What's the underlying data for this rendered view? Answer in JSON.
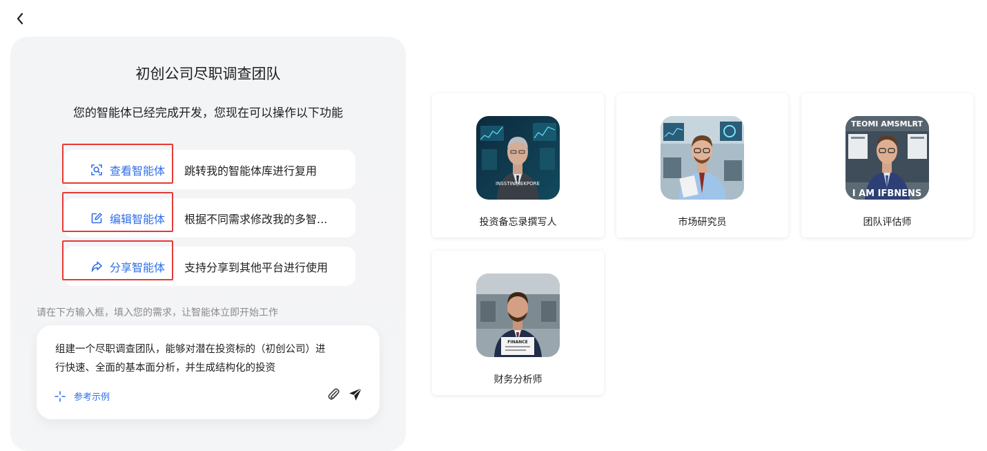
{
  "header": {
    "back_icon": "chevron-left-icon"
  },
  "panel": {
    "title": "初创公司尽职调查团队",
    "subtitle": "您的智能体已经完成开发，您现在可以操作以下功能",
    "actions": [
      {
        "label": "查看智能体",
        "description": "跳转我的智能体库进行复用",
        "icon": "view-search-icon"
      },
      {
        "label": "编辑智能体",
        "description": "根据不同需求修改我的多智...",
        "icon": "edit-icon"
      },
      {
        "label": "分享智能体",
        "description": "支持分享到其他平台进行使用",
        "icon": "share-icon"
      }
    ],
    "hint": "请在下方输入框，填入您的需求，让智能体立即开始工作",
    "input": {
      "value": "组建一个尽职调查团队，能够对潜在投资标的（初创公司）进行快速、全面的基本面分析，并生成结构化的投资",
      "example_label": "参考示例"
    }
  },
  "agents": [
    {
      "name": "投资备忘录撰写人",
      "poster_text": "INSSTINIMEKPORE"
    },
    {
      "name": "市场研究员",
      "poster_text": ""
    },
    {
      "name": "团队评估师",
      "poster_text": "TEOMI AMSMLRT",
      "poster_text_2": "I AM IFBNENS"
    },
    {
      "name": "财务分析师",
      "poster_text": "FINANCE"
    }
  ],
  "colors": {
    "accent": "#2f6fe8",
    "highlight": "#e53935",
    "panel_bg": "#f3f4f6"
  }
}
